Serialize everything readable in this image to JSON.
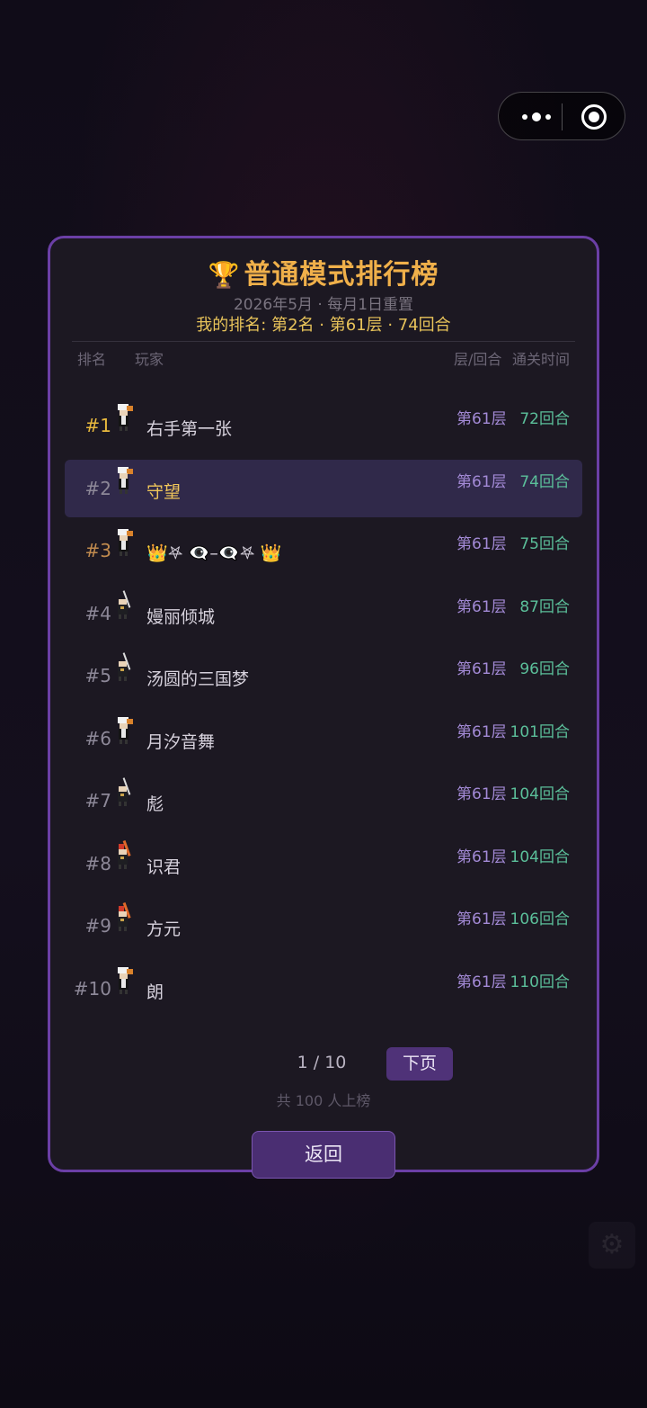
{
  "leaderboard": {
    "title": "普通模式排行榜",
    "trophy_icon": "trophy-icon",
    "subtitle": "2026年5月 · 每月1日重置",
    "my_rank": "我的排名: 第2名 · 第61层 · 74回合",
    "headers": {
      "rank": "排名",
      "player": "玩家",
      "floor_round": "层/回合",
      "clear_time": "通关时间"
    },
    "rows": [
      {
        "rank": "#1",
        "name": "右手第一张",
        "floor": "第61层",
        "rounds": "72回合",
        "avatar": "chef-avatar",
        "highlight": false
      },
      {
        "rank": "#2",
        "name": "守望",
        "floor": "第61层",
        "rounds": "74回合",
        "avatar": "chef-avatar",
        "highlight": true
      },
      {
        "rank": "#3",
        "name": "👑𖤐 👁‍🗨–👁‍🗨𖤐  👑",
        "floor": "第61层",
        "rounds": "75回合",
        "avatar": "chef-avatar",
        "highlight": false
      },
      {
        "rank": "#4",
        "name": "嫚丽倾城",
        "floor": "第61层",
        "rounds": "87回合",
        "avatar": "swordsman-avatar",
        "highlight": false
      },
      {
        "rank": "#5",
        "name": "汤圆的三国梦",
        "floor": "第61层",
        "rounds": "96回合",
        "avatar": "swordsman-avatar",
        "highlight": false
      },
      {
        "rank": "#6",
        "name": "月汐音舞",
        "floor": "第61层",
        "rounds": "101回合",
        "avatar": "chef-avatar",
        "highlight": false
      },
      {
        "rank": "#7",
        "name": "彪",
        "floor": "第61层",
        "rounds": "104回合",
        "avatar": "swordsman-avatar",
        "highlight": false
      },
      {
        "rank": "#8",
        "name": "识君",
        "floor": "第61层",
        "rounds": "104回合",
        "avatar": "fire-swordsman-avatar",
        "highlight": false
      },
      {
        "rank": "#9",
        "name": "方元",
        "floor": "第61层",
        "rounds": "106回合",
        "avatar": "fire-swordsman-avatar",
        "highlight": false
      },
      {
        "rank": "#10",
        "name": "朗",
        "floor": "第61层",
        "rounds": "110回合",
        "avatar": "chef-avatar",
        "highlight": false
      }
    ],
    "pager": {
      "page": "1 / 10",
      "next_label": "下页",
      "total": "共 100 人上榜"
    },
    "back_label": "返回"
  },
  "colors": {
    "accent": "#6b3fa6",
    "title": "#f0b04a",
    "floor": "#a38ad6",
    "rounds": "#5bbf9a",
    "highlight_row": "#30294a"
  }
}
